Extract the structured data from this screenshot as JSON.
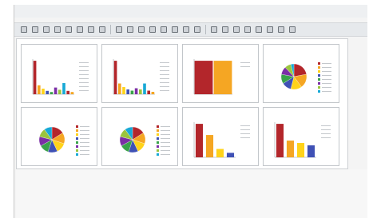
{
  "window": {
    "title": "",
    "menu": [
      "",
      "",
      "",
      "",
      ""
    ]
  },
  "toolbar": {
    "buttons": [
      "icon",
      "icon",
      "icon",
      "icon",
      "icon",
      "icon",
      "icon",
      "icon",
      "icon",
      "icon",
      "icon",
      "icon",
      "icon",
      "icon",
      "icon",
      "icon",
      "icon",
      "icon",
      "icon",
      "icon",
      "icon",
      "icon",
      "icon",
      "icon"
    ]
  },
  "colors": {
    "red": "#b3262b",
    "orange": "#f5a623",
    "yellow": "#ffd31a",
    "blue": "#3f51b5",
    "green": "#39a34a",
    "purple": "#7b2fa6",
    "lime": "#9bc53d",
    "cyan": "#18a9d6"
  },
  "chart_data": [
    {
      "type": "bar",
      "title": "",
      "values": [
        30,
        8,
        5,
        3,
        2,
        6,
        4,
        10,
        3,
        2
      ]
    },
    {
      "type": "bar",
      "title": "",
      "values": [
        28,
        9,
        6,
        4,
        3,
        5,
        4,
        9,
        3,
        2
      ]
    },
    {
      "type": "bar",
      "title": "",
      "values": [
        80,
        80
      ]
    },
    {
      "type": "pie",
      "title": "",
      "values": [
        22,
        18,
        14,
        12,
        12,
        10,
        8,
        4
      ]
    },
    {
      "type": "pie",
      "title": "",
      "values": [
        16,
        14,
        13,
        12,
        12,
        12,
        11,
        10
      ]
    },
    {
      "type": "pie",
      "title": "",
      "values": [
        16,
        14,
        13,
        12,
        12,
        12,
        11,
        10
      ]
    },
    {
      "type": "bar",
      "title": "",
      "values": [
        60,
        40,
        15,
        8
      ]
    },
    {
      "type": "bar",
      "title": "",
      "values": [
        70,
        35,
        30,
        25
      ]
    }
  ]
}
